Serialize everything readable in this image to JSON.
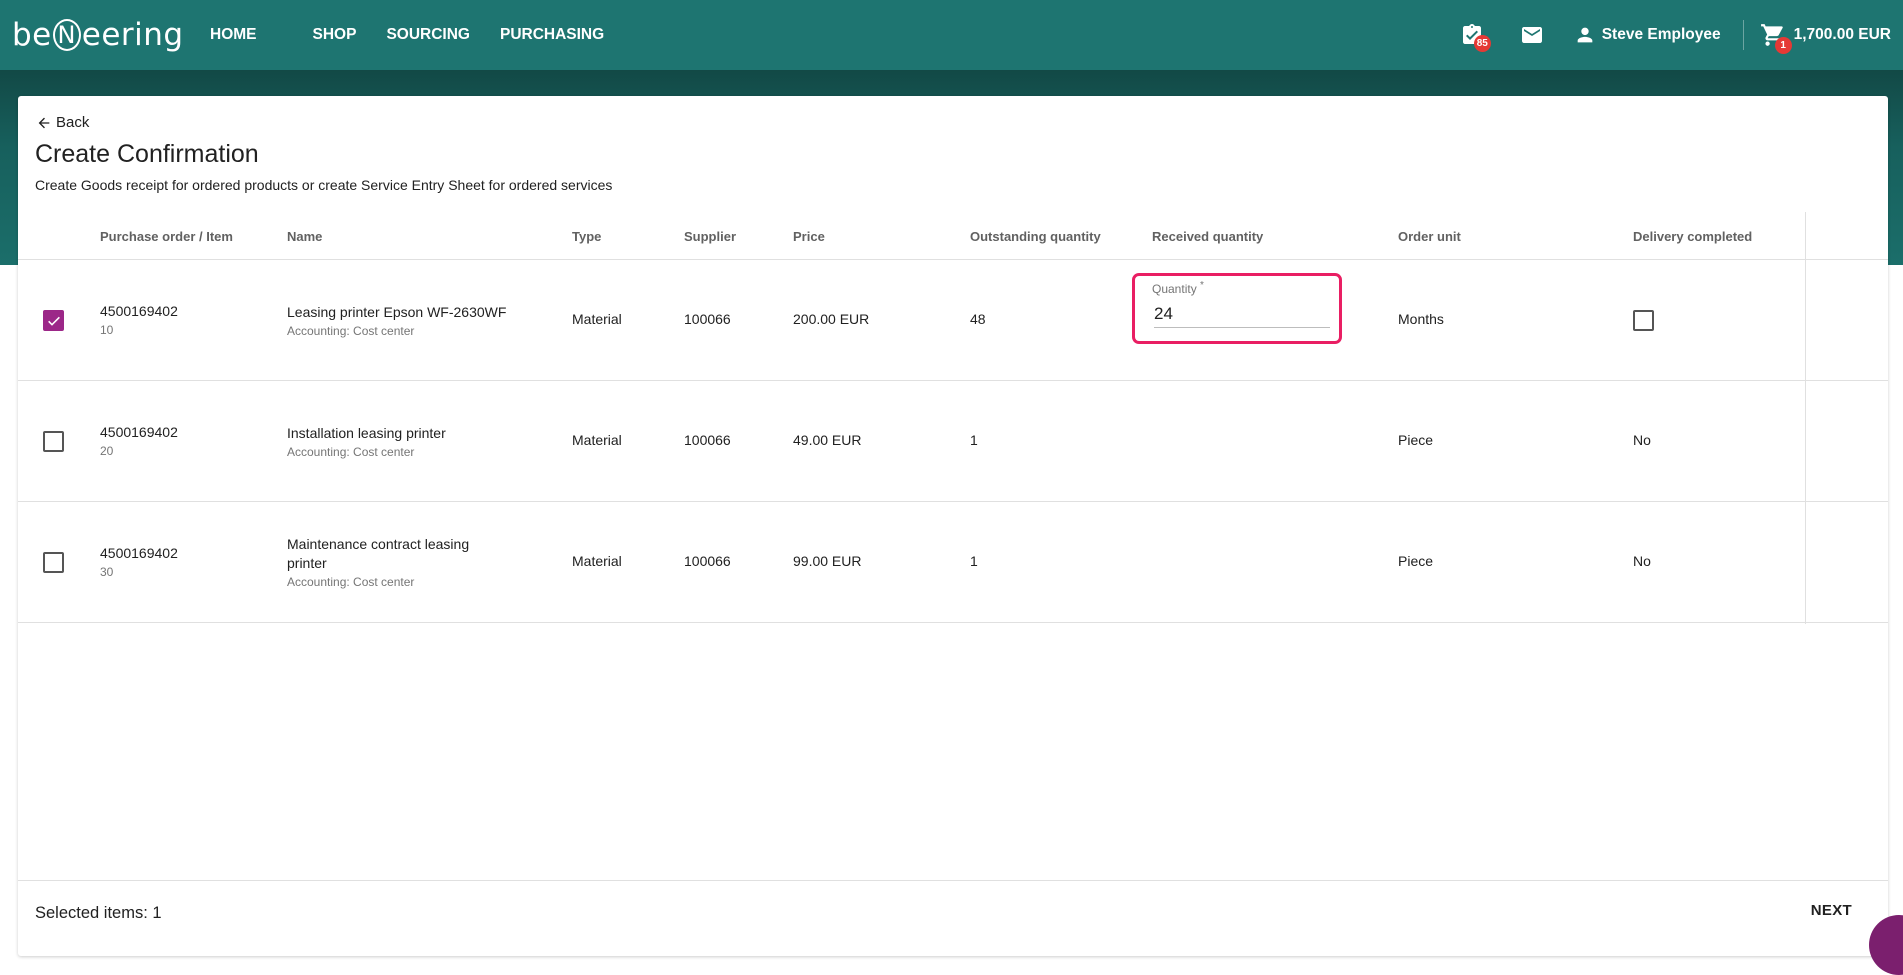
{
  "brand": {
    "logo_left": "be",
    "logo_mid": "N",
    "logo_right": "eering"
  },
  "nav": {
    "items": [
      {
        "label": "HOME"
      },
      {
        "label": "SHOP"
      },
      {
        "label": "SOURCING"
      },
      {
        "label": "PURCHASING"
      }
    ]
  },
  "header": {
    "tasks_badge": "85",
    "user_name": "Steve Employee",
    "cart_badge": "1",
    "cart_total": "1,700.00 EUR",
    "icons": [
      "task-check-icon",
      "mail-icon",
      "person-icon",
      "cart-icon"
    ]
  },
  "page": {
    "back_label": "Back",
    "title": "Create Confirmation",
    "subtitle": "Create Goods receipt for ordered products or create Service Entry Sheet for ordered services"
  },
  "table": {
    "columns": [
      "Purchase order / Item",
      "Name",
      "Type",
      "Supplier",
      "Price",
      "Outstanding quantity",
      "Received quantity",
      "Order unit",
      "Delivery completed"
    ],
    "rows": [
      {
        "checked": true,
        "po": "4500169402",
        "item": "10",
        "name": "Leasing printer Epson WF-2630WF",
        "accounting": "Accounting:  Cost center",
        "type": "Material",
        "supplier": "100066",
        "price": "200.00 EUR",
        "outstanding": "48",
        "quantity_label": "Quantity",
        "quantity_required": "*",
        "quantity_value": "24",
        "unit": "Months",
        "delivery_completed_checked": false
      },
      {
        "checked": false,
        "po": "4500169402",
        "item": "20",
        "name": "Installation leasing printer",
        "accounting": "Accounting:  Cost center",
        "type": "Material",
        "supplier": "100066",
        "price": "49.00 EUR",
        "outstanding": "1",
        "unit": "Piece",
        "delivery_completed": "No"
      },
      {
        "checked": false,
        "po": "4500169402",
        "item": "30",
        "name": "Maintenance contract leasing printer",
        "accounting": "Accounting:  Cost center",
        "type": "Material",
        "supplier": "100066",
        "price": "99.00 EUR",
        "outstanding": "1",
        "unit": "Piece",
        "delivery_completed": "No"
      }
    ]
  },
  "footer": {
    "selected_label": "Selected items: 1",
    "next_label": "NEXT"
  },
  "colors": {
    "header": "#1e7571",
    "checkbox_checked": "#9c2788",
    "highlight": "#e91e63",
    "badge": "#e53935"
  }
}
